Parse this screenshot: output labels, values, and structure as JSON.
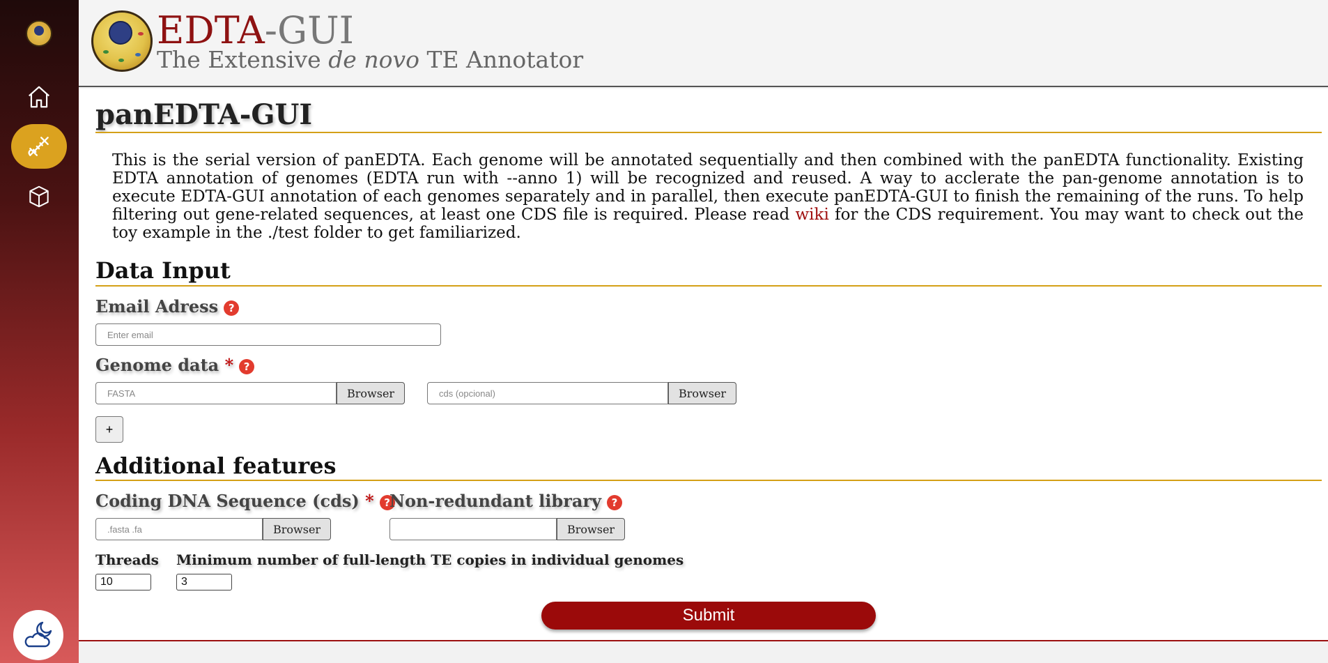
{
  "header": {
    "title_main": "EDTA",
    "title_suffix": "-GUI",
    "subtitle_before": "The Extensive ",
    "subtitle_italic": "de novo",
    "subtitle_after": " TE Annotator"
  },
  "sidebar": {
    "items": [
      {
        "icon": "home-icon"
      },
      {
        "icon": "dna-icon",
        "active": true
      },
      {
        "icon": "cube-icon"
      }
    ],
    "theme_toggle": {
      "icon": "moon-cloud-icon"
    },
    "active_color": "#dba21f"
  },
  "main": {
    "page_title": "panEDTA-GUI",
    "description_part1": "This is the serial version of panEDTA. Each genome will be annotated sequentially and then combined with the panEDTA functionality. Existing EDTA annotation of genomes (EDTA run with --anno 1) will be recognized and reused. A way to acclerate the pan-genome annotation is to execute EDTA-GUI annotation of each genomes separately and in parallel, then execute panEDTA-GUI to finish the remaining of the runs. To help filtering out gene-related sequences, at least one CDS file is required. Please read ",
    "description_link": "wiki",
    "description_part2": " for the CDS requirement. You may want to check out the toy example in the ./test folder to get familiarized.",
    "data_input": {
      "section_title": "Data Input",
      "email_label": "Email Adress",
      "email_placeholder": "Enter email",
      "genome_label": "Genome data",
      "required_mark": "*",
      "fasta_placeholder": "FASTA",
      "cds_placeholder": "cds (opcional)",
      "browse_label": "Browser",
      "add_label": "+"
    },
    "additional": {
      "section_title": "Additional features",
      "cds_label": "Coding DNA Sequence (cds)",
      "cds_placeholder": ".fasta .fa",
      "nr_library_label": "Non-redundant library",
      "nr_library_placeholder": "",
      "threads_label": "Threads",
      "threads_value": "10",
      "min_copies_label": "Minimum number of full-length TE copies in individual genomes",
      "min_copies_value": "3"
    },
    "submit_label": "Submit",
    "help_glyph": "?"
  },
  "colors": {
    "brand_red": "#8e1212",
    "accent_gold": "#d4a017",
    "submit": "#9b0a0a"
  }
}
